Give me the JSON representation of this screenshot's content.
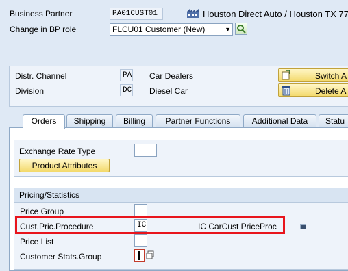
{
  "header": {
    "bp_label": "Business Partner",
    "bp_value": "PA01CUST01",
    "bp_description": "Houston Direct Auto / Houston TX 77(",
    "role_label": "Change in BP role",
    "role_value": "FLCU01 Customer (New)"
  },
  "sales_area": {
    "distr_channel_label": "Distr. Channel",
    "distr_channel_code": "PA",
    "distr_channel_text": "Car Dealers",
    "division_label": "Division",
    "division_code": "DC",
    "division_text": "Diesel Car",
    "switch_button": "Switch A",
    "delete_button": "Delete A"
  },
  "tabs": [
    "Orders",
    "Shipping",
    "Billing",
    "Partner Functions",
    "Additional Data",
    "Statu"
  ],
  "orders": {
    "exchange_rate_label": "Exchange Rate Type",
    "exchange_rate_value": "",
    "product_attributes_button": "Product Attributes",
    "pricing_group_title": "Pricing/Statistics",
    "price_group_label": "Price Group",
    "price_group_value": "",
    "cust_pric_proc_label": "Cust.Pric.Procedure",
    "cust_pric_proc_value": "IC",
    "cust_pric_proc_text": "IC CarCust PriceProc",
    "price_list_label": "Price List",
    "price_list_value": "",
    "cust_stats_label": "Customer Stats.Group",
    "cust_stats_value": ""
  },
  "colors": {
    "highlight_border": "#e8141c",
    "background": "#dfe9f5",
    "button_yellow": "#f3d96b"
  }
}
